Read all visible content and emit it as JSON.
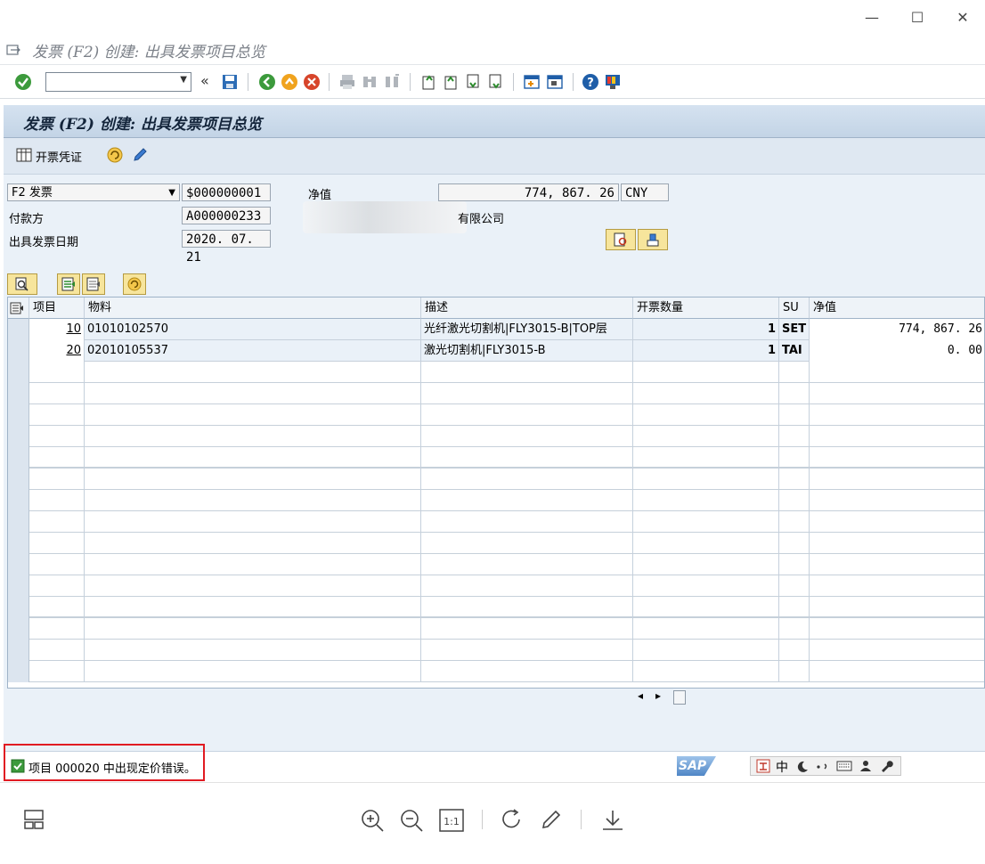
{
  "window": {
    "minimize": "—",
    "maximize": "☐",
    "close": "✕"
  },
  "title": "发票 (F2) 创建: 出具发票项目总览",
  "screen_title": "发票 (F2) 创建: 出具发票项目总览",
  "app_toolbar": {
    "billing_docs_label": "开票凭证"
  },
  "header": {
    "doc_type": "F2 发票",
    "doc_number": "$000000001",
    "net_value_label": "净值",
    "net_value": "774, 867. 26",
    "currency": "CNY",
    "payer_label": "付款方",
    "payer": "A000000233",
    "payer_name_suffix": "有限公司",
    "billing_date_label": "出具发票日期",
    "billing_date": "2020. 07. 21"
  },
  "table": {
    "columns": [
      "项目",
      "物料",
      "描述",
      "开票数量",
      "SU",
      "净值"
    ],
    "rows": [
      {
        "item": "10",
        "material": "01010102570",
        "desc": "光纤激光切割机|FLY3015-B|TOP层",
        "qty": "1",
        "su": "SET",
        "net": "774, 867. 26"
      },
      {
        "item": "20",
        "material": "02010105537",
        "desc": "激光切割机|FLY3015-B",
        "qty": "1",
        "su": "TAI",
        "net": "0. 00"
      }
    ],
    "scroll_left": "◂",
    "scroll_right": "▸"
  },
  "status": {
    "message": "项目 000020 中出现定价错误。",
    "sap_logo": "SAP",
    "ime_chinese": "中"
  },
  "colors": {
    "status_highlight": "#e11b22",
    "screen_bg": "#eaf1f8",
    "header_bg": "#c3d4e6"
  }
}
